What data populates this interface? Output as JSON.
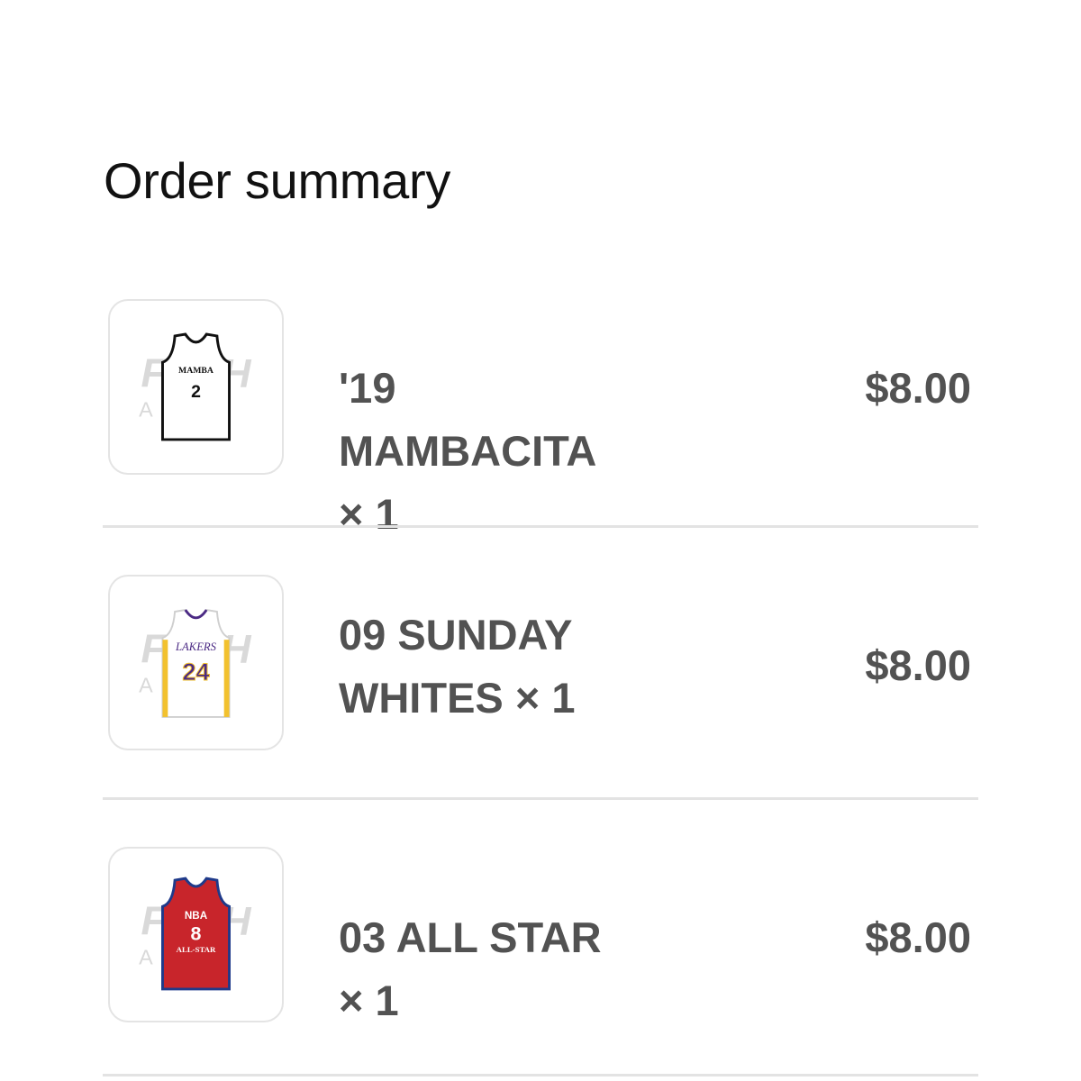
{
  "header": {
    "title": "Order summary"
  },
  "items": [
    {
      "name": "'19 MAMBACITA × 1",
      "price": "$8.00",
      "thumb_icon": "white-mamba-jersey-icon",
      "jersey_text": "MAMBA",
      "jersey_number": "2",
      "colors": {
        "body": "#ffffff",
        "trim": "#111111"
      }
    },
    {
      "name": "09 SUNDAY WHITES × 1",
      "price": "$8.00",
      "thumb_icon": "white-lakers-jersey-icon",
      "jersey_text": "LAKERS",
      "jersey_number": "24",
      "colors": {
        "body": "#ffffff",
        "trim": "#f2c12e",
        "accent": "#4b2a84"
      }
    },
    {
      "name": "03 ALL STAR × 1",
      "price": "$8.00",
      "thumb_icon": "red-all-star-jersey-icon",
      "jersey_text": "NBA",
      "jersey_number": "8",
      "jersey_subtext": "ALL-STAR",
      "colors": {
        "body": "#c8252b",
        "trim": "#1f3a8a"
      }
    }
  ],
  "watermark": {
    "top": "FRSH",
    "bottom": "AIR"
  },
  "colors": {
    "text_primary": "#111111",
    "text_secondary": "#525252",
    "divider": "#e3e3e3",
    "border": "#e4e4e4"
  }
}
